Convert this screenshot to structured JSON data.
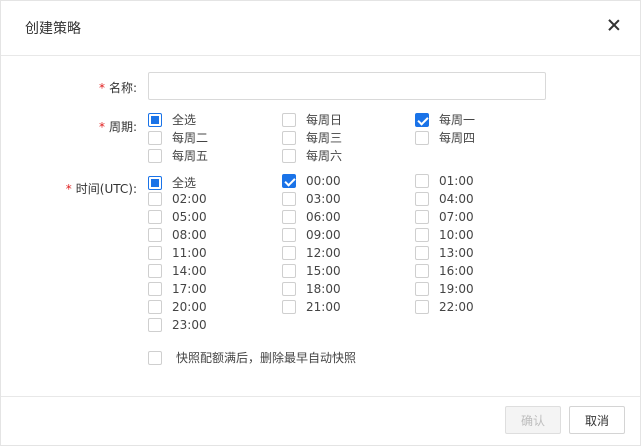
{
  "dialog": {
    "title": "创建策略",
    "confirm_label": "确认",
    "cancel_label": "取消"
  },
  "form": {
    "name_label": "名称:",
    "name_value": "",
    "name_placeholder": "",
    "period_label": "周期:",
    "time_label": "时间(UTC):",
    "required_mark": "*"
  },
  "period_options": [
    {
      "label": "全选",
      "state": "partial"
    },
    {
      "label": "每周日",
      "state": "unchecked"
    },
    {
      "label": "每周一",
      "state": "checked"
    },
    {
      "label": "每周二",
      "state": "unchecked"
    },
    {
      "label": "每周三",
      "state": "unchecked"
    },
    {
      "label": "每周四",
      "state": "unchecked"
    },
    {
      "label": "每周五",
      "state": "unchecked"
    },
    {
      "label": "每周六",
      "state": "unchecked"
    }
  ],
  "time_options": [
    {
      "label": "全选",
      "state": "partial"
    },
    {
      "label": "00:00",
      "state": "checked"
    },
    {
      "label": "01:00",
      "state": "unchecked"
    },
    {
      "label": "02:00",
      "state": "unchecked"
    },
    {
      "label": "03:00",
      "state": "unchecked"
    },
    {
      "label": "04:00",
      "state": "unchecked"
    },
    {
      "label": "05:00",
      "state": "unchecked"
    },
    {
      "label": "06:00",
      "state": "unchecked"
    },
    {
      "label": "07:00",
      "state": "unchecked"
    },
    {
      "label": "08:00",
      "state": "unchecked"
    },
    {
      "label": "09:00",
      "state": "unchecked"
    },
    {
      "label": "10:00",
      "state": "unchecked"
    },
    {
      "label": "11:00",
      "state": "unchecked"
    },
    {
      "label": "12:00",
      "state": "unchecked"
    },
    {
      "label": "13:00",
      "state": "unchecked"
    },
    {
      "label": "14:00",
      "state": "unchecked"
    },
    {
      "label": "15:00",
      "state": "unchecked"
    },
    {
      "label": "16:00",
      "state": "unchecked"
    },
    {
      "label": "17:00",
      "state": "unchecked"
    },
    {
      "label": "18:00",
      "state": "unchecked"
    },
    {
      "label": "19:00",
      "state": "unchecked"
    },
    {
      "label": "20:00",
      "state": "unchecked"
    },
    {
      "label": "21:00",
      "state": "unchecked"
    },
    {
      "label": "22:00",
      "state": "unchecked"
    },
    {
      "label": "23:00",
      "state": "unchecked"
    }
  ],
  "auto_delete": {
    "label": "快照配额满后，删除最早自动快照",
    "state": "unchecked"
  },
  "colors": {
    "accent": "#1a73e8",
    "required": "#e02020"
  }
}
